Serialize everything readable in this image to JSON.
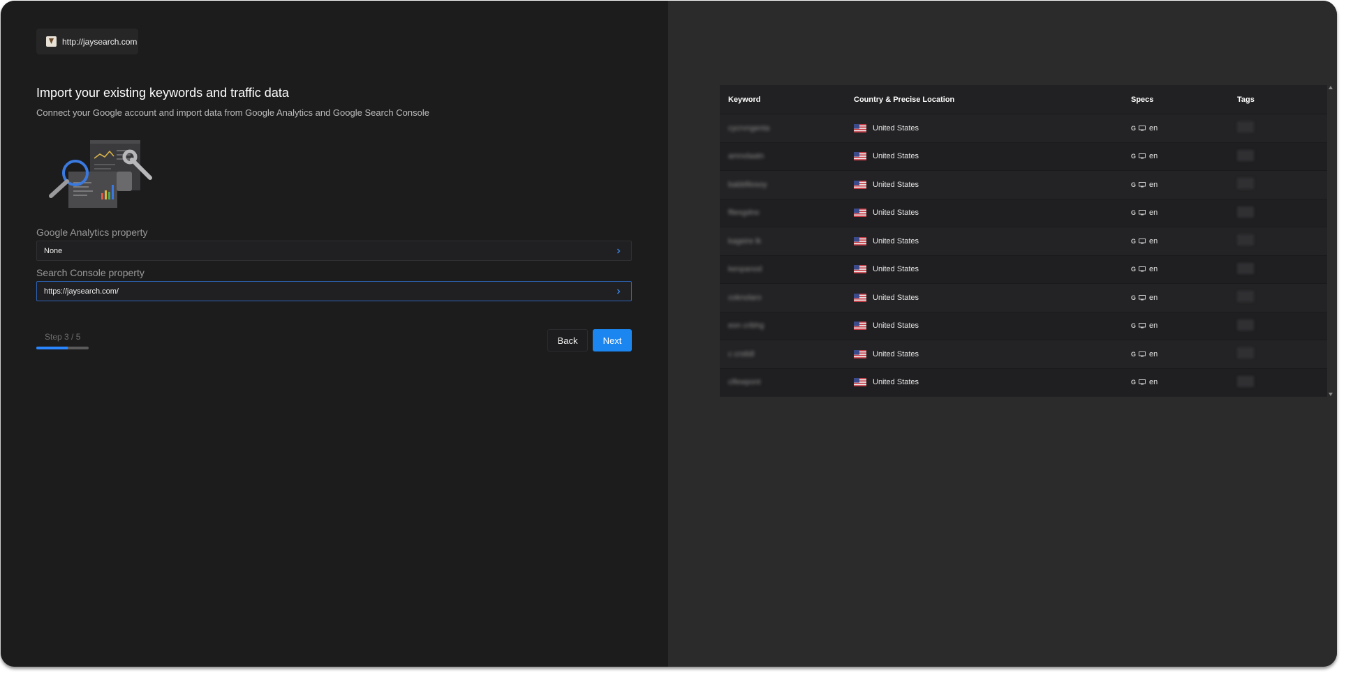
{
  "site": {
    "url": "http://jaysearch.com"
  },
  "heading": {
    "title": "Import your existing keywords and traffic data",
    "subtitle": "Connect your Google account and import data from Google Analytics and Google Search Console"
  },
  "form": {
    "analytics_label": "Google Analytics property",
    "analytics_value": "None",
    "console_label": "Search Console property",
    "console_value": "https://jaysearch.com/"
  },
  "step": {
    "label": "Step 3 / 5",
    "progress_fraction": 0.6
  },
  "buttons": {
    "back": "Back",
    "next": "Next"
  },
  "colors": {
    "accent": "#1b86f0",
    "panel_left": "#1c1c1d",
    "panel_right": "#2b2b2b"
  },
  "table": {
    "headers": {
      "keyword": "Keyword",
      "country": "Country & Precise Location",
      "specs": "Specs",
      "tags": "Tags"
    },
    "rows": [
      {
        "keyword": "cycrvngenta",
        "country": "United States",
        "lang": "en",
        "tag": "Tag"
      },
      {
        "keyword": "amnolaatn",
        "country": "United States",
        "lang": "en",
        "tag": "Tag"
      },
      {
        "keyword": "babbfilosoy",
        "country": "United States",
        "lang": "en",
        "tag": "Tag"
      },
      {
        "keyword": "fltesgdno",
        "country": "United States",
        "lang": "en",
        "tag": "Tag"
      },
      {
        "keyword": "kageire lk",
        "country": "United States",
        "lang": "en",
        "tag": "Tag"
      },
      {
        "keyword": "kenpanod",
        "country": "United States",
        "lang": "en",
        "tag": "Tag"
      },
      {
        "keyword": "coknolaro",
        "country": "United States",
        "lang": "en",
        "tag": "Tag"
      },
      {
        "keyword": "eon cribhg",
        "country": "United States",
        "lang": "en",
        "tag": "Tag"
      },
      {
        "keyword": "c crstldl",
        "country": "United States",
        "lang": "en",
        "tag": "Tag"
      },
      {
        "keyword": "clfewpont",
        "country": "United States",
        "lang": "en",
        "tag": "Tag"
      }
    ]
  }
}
